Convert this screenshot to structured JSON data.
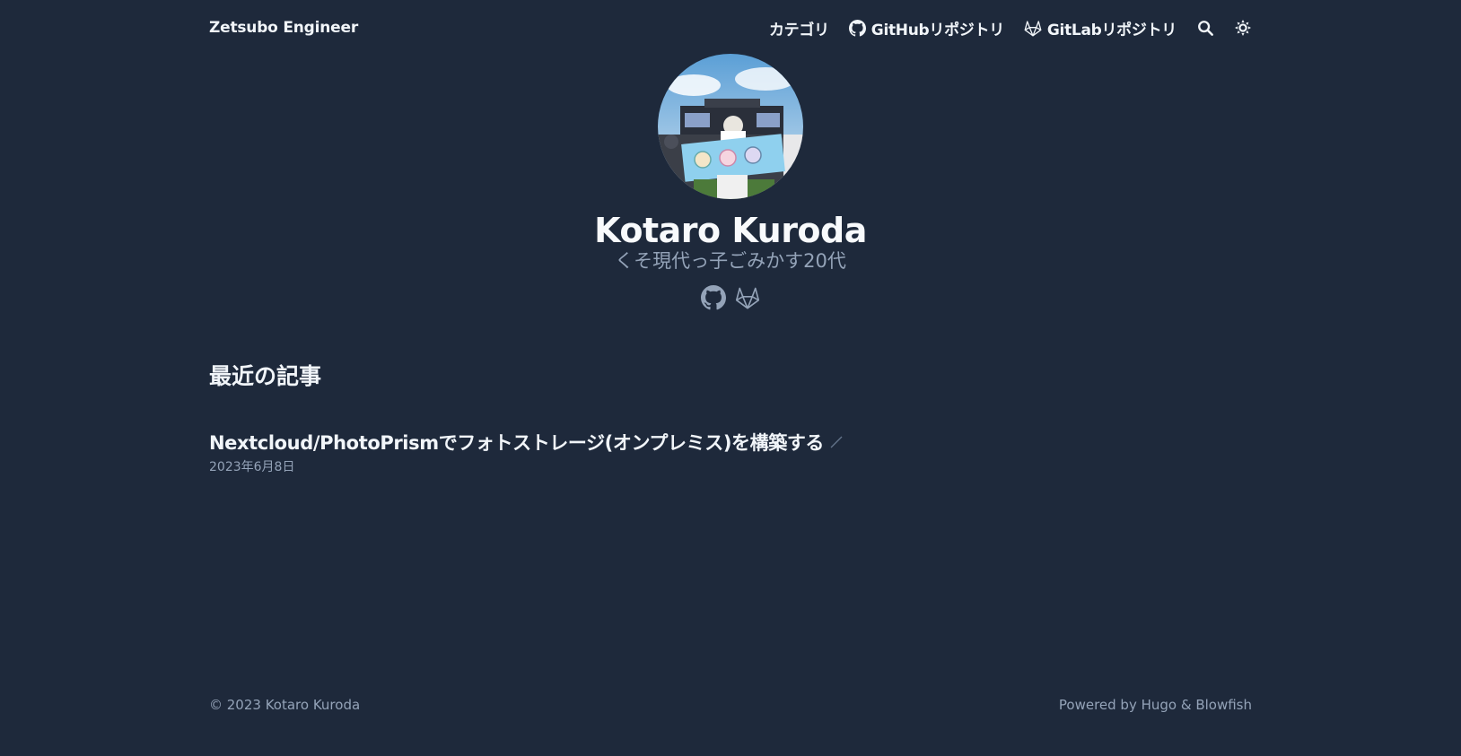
{
  "header": {
    "brand": "Zetsubo Engineer",
    "nav": [
      {
        "label": "カテゴリ",
        "icon": null
      },
      {
        "label": "GitHubリポジトリ",
        "icon": "github-icon"
      },
      {
        "label": "GitLabリポジトリ",
        "icon": "gitlab-icon"
      }
    ],
    "search_icon": "search-icon",
    "theme_icon": "sun-icon"
  },
  "profile": {
    "name": "Kotaro Kuroda",
    "headline": "くそ現代っ子ごみかす20代",
    "social": [
      "github-icon",
      "gitlab-icon"
    ]
  },
  "recent": {
    "title": "最近の記事",
    "articles": [
      {
        "title": "Nextcloud/PhotoPrismでフォトストレージ(オンプレミス)を構築する",
        "date": "2023年6月8日"
      }
    ]
  },
  "footer": {
    "copyright": "© 2023 Kotaro Kuroda",
    "powered": "Powered by Hugo & Blowfish"
  },
  "colors": {
    "background": "#1e293b",
    "text": "#f1f5f9",
    "muted": "#94a3b8"
  }
}
